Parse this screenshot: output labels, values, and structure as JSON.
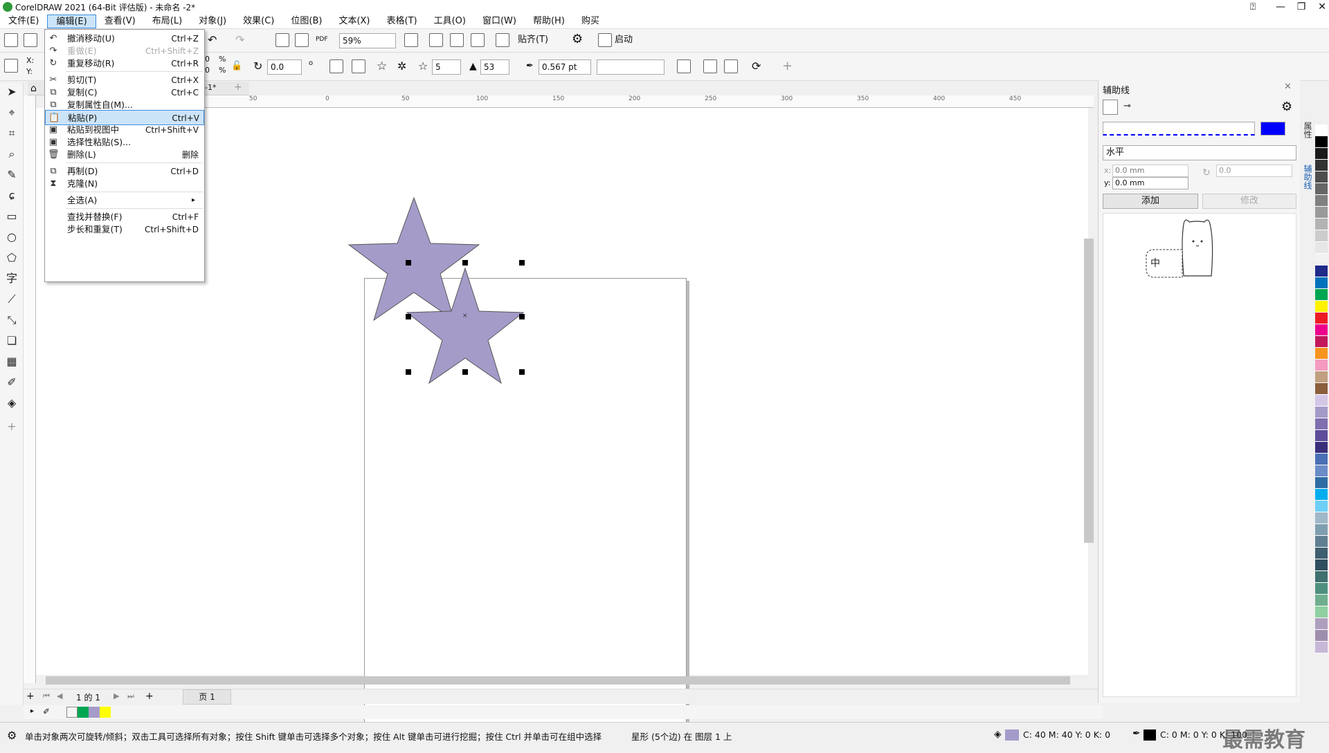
{
  "window": {
    "title": "CorelDRAW 2021 (64-Bit 评估版) - 未命名 -2*"
  },
  "menu": [
    "文件(E)",
    "编辑(E)",
    "查看(V)",
    "布局(L)",
    "对象(J)",
    "效果(C)",
    "位图(B)",
    "文本(X)",
    "表格(T)",
    "工具(O)",
    "窗口(W)",
    "帮助(H)",
    "购买"
  ],
  "edit_menu": [
    {
      "label": "撤消移动(U)",
      "shortcut": "Ctrl+Z",
      "icon": "undo-icon"
    },
    {
      "label": "重做(E)",
      "shortcut": "Ctrl+Shift+Z",
      "icon": "redo-icon"
    },
    {
      "label": "重复移动(R)",
      "shortcut": "Ctrl+R",
      "icon": "repeat-icon"
    },
    {
      "label": "剪切(T)",
      "shortcut": "Ctrl+X",
      "icon": "cut-icon"
    },
    {
      "label": "复制(C)",
      "shortcut": "Ctrl+C",
      "icon": "copy-icon"
    },
    {
      "label": "复制属性自(M)...",
      "shortcut": "",
      "icon": "copy-properties-icon"
    },
    {
      "label": "粘贴(P)",
      "shortcut": "Ctrl+V",
      "icon": "paste-icon"
    },
    {
      "label": "粘贴到视图中",
      "shortcut": "Ctrl+Shift+V",
      "icon": "paste-in-view-icon"
    },
    {
      "label": "选择性粘贴(S)...",
      "shortcut": "",
      "icon": "paste-special-icon"
    },
    {
      "label": "删除(L)",
      "shortcut": "删除",
      "icon": "delete-icon"
    },
    {
      "label": "再制(D)",
      "shortcut": "Ctrl+D",
      "icon": "duplicate-icon"
    },
    {
      "label": "克隆(N)",
      "shortcut": "",
      "icon": "clone-icon"
    },
    {
      "label": "全选(A)",
      "shortcut": "",
      "icon": "",
      "submenu": "▸"
    },
    {
      "label": "查找并替换(F)",
      "shortcut": "Ctrl+F",
      "icon": ""
    },
    {
      "label": "步长和重复(T)",
      "shortcut": "Ctrl+Shift+D",
      "icon": ""
    }
  ],
  "toolbar": {
    "zoom": "59%",
    "paste_label": "贴齐(T)",
    "launch_label": "启动",
    "rotation": "0.0",
    "points": "5",
    "sharpness": "53",
    "outline_width": "0.567 pt",
    "pos_x_label": "X:",
    "pos_y_label": "Y:",
    "scale_x": "0",
    "scale_y": "0",
    "percent": "%",
    "degree": "o",
    "doc_tab": "-1*"
  },
  "ruler": {
    "h_ticks": [
      "50",
      "0",
      "50",
      "100",
      "150",
      "200",
      "250",
      "300",
      "350",
      "400",
      "450"
    ]
  },
  "canvas": {
    "shape_color": "#a59bc9",
    "outline_color": "#555555"
  },
  "page_nav": {
    "counter": "1 的 1",
    "tab": "页 1"
  },
  "guides_panel": {
    "title": "辅助线",
    "orientation": "水平",
    "x_label": "x:",
    "y_label": "y:",
    "x_value": "0.0 mm",
    "y_value": "0.0 mm",
    "angle_value": "0.0",
    "add_button": "添加",
    "modify_button": "修改",
    "line_color": "#0000ff",
    "side_tabs": [
      "属性",
      "辅助线"
    ],
    "sticker_text": "中"
  },
  "status": {
    "hint": "单击对象两次可旋转/倾斜；双击工具可选择所有对象；按住 Shift 键单击可选择多个对象；按住 Alt 键单击可进行挖掘；按住 Ctrl 并单击可在组中选择",
    "object_info": "星形 (5个边) 在 图层 1 上",
    "fill_cmyk": "C: 40 M: 40 Y: 0 K: 0",
    "outline_cmyk": "C: 0 M: 0 Y: 0 K: 100",
    "watermark": "最需教育"
  },
  "doc_palette": [
    "#ffffff",
    "#00a651",
    "#a59bc9",
    "#ffff00"
  ],
  "palette_colors": [
    "#ffffff",
    "#000000",
    "#1a1a1a",
    "#333333",
    "#4d4d4d",
    "#666666",
    "#808080",
    "#999999",
    "#b3b3b3",
    "#cccccc",
    "#e6e6e6",
    "#f2f2f2",
    "#1f2a8a",
    "#0072bc",
    "#00a651",
    "#fff200",
    "#ed1c24",
    "#ec008c",
    "#c2185b",
    "#f7941d",
    "#f49ac1",
    "#c0a080",
    "#8b5e3c",
    "#d4c7e6",
    "#a59bc9",
    "#7f6faf",
    "#5c4c9a",
    "#3b2f7a",
    "#4a6fb5",
    "#6a8cc7",
    "#2e6da4",
    "#00aeef",
    "#6dcff6",
    "#9fb8c8",
    "#7f9fb0",
    "#5f7f90",
    "#3f5f70",
    "#2f4f5f",
    "#3f6f6f",
    "#4f8f7f",
    "#6faf8f",
    "#8fcfa0",
    "#af9fbf",
    "#9f8faf",
    "#c8b8d8"
  ]
}
